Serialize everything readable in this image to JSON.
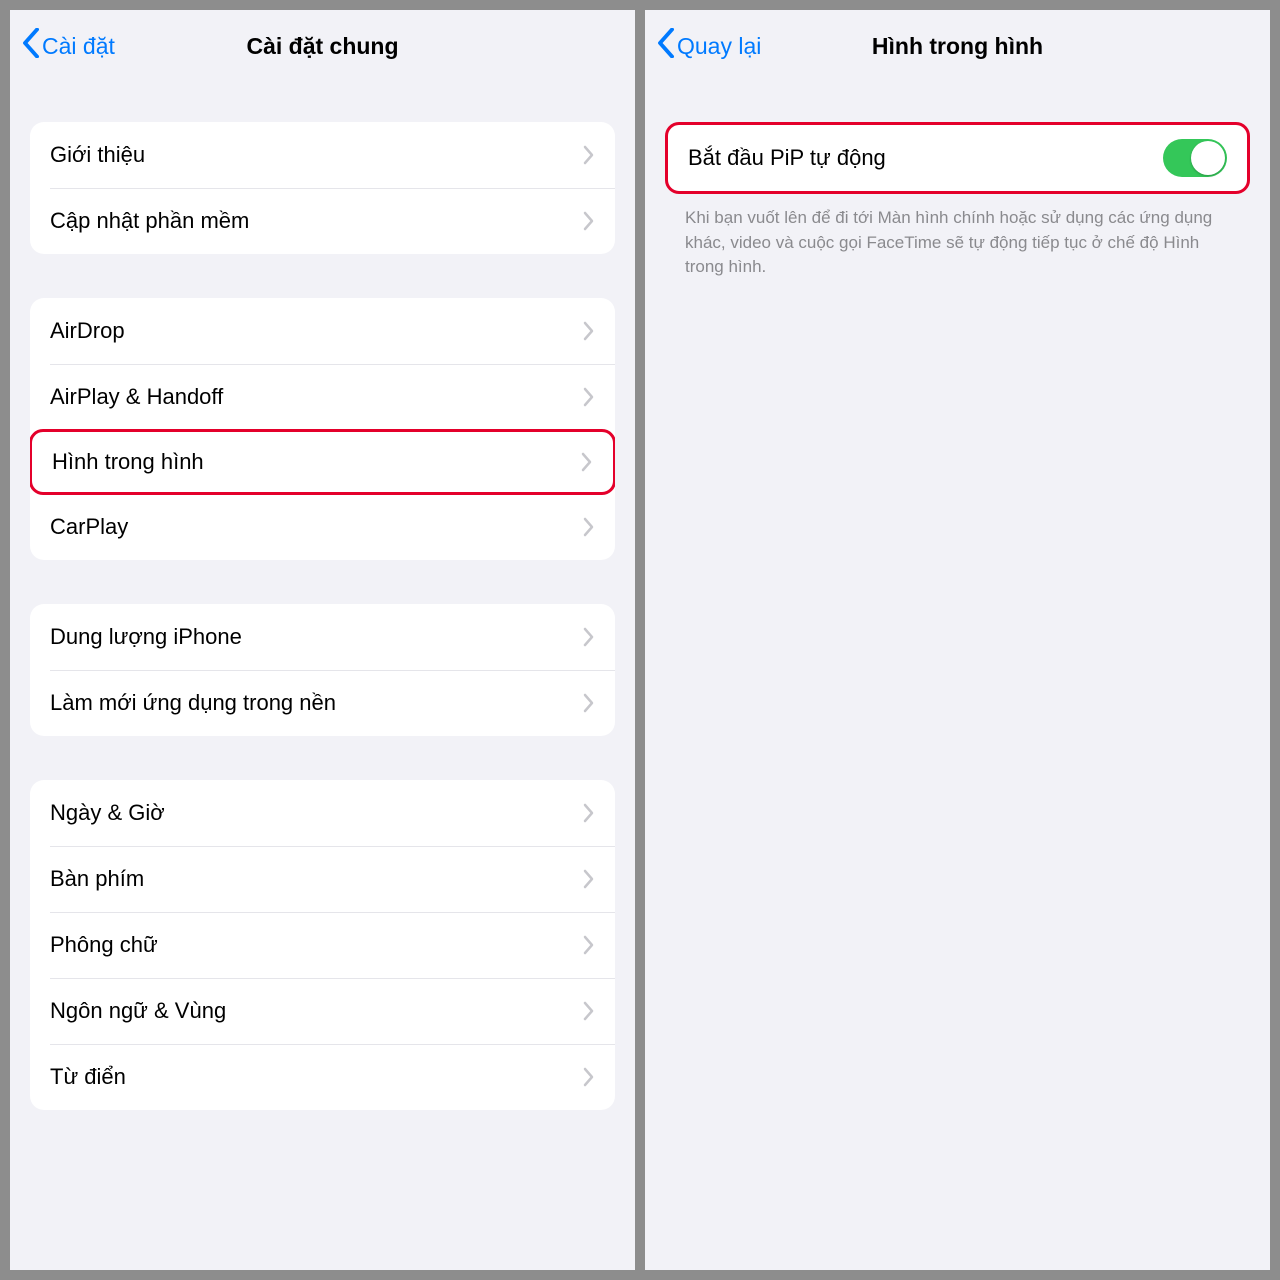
{
  "left": {
    "back_label": "Cài đặt",
    "title": "Cài đặt chung",
    "groups": [
      {
        "items": [
          {
            "label": "Giới thiệu",
            "highlight": false
          },
          {
            "label": "Cập nhật phần mềm",
            "highlight": false
          }
        ]
      },
      {
        "items": [
          {
            "label": "AirDrop",
            "highlight": false
          },
          {
            "label": "AirPlay & Handoff",
            "highlight": false
          },
          {
            "label": "Hình trong hình",
            "highlight": true
          },
          {
            "label": "CarPlay",
            "highlight": false
          }
        ]
      },
      {
        "items": [
          {
            "label": "Dung lượng iPhone",
            "highlight": false
          },
          {
            "label": "Làm mới ứng dụng trong nền",
            "highlight": false
          }
        ]
      },
      {
        "items": [
          {
            "label": "Ngày & Giờ",
            "highlight": false
          },
          {
            "label": "Bàn phím",
            "highlight": false
          },
          {
            "label": "Phông chữ",
            "highlight": false
          },
          {
            "label": "Ngôn ngữ & Vùng",
            "highlight": false
          },
          {
            "label": "Từ điển",
            "highlight": false
          }
        ]
      }
    ]
  },
  "right": {
    "back_label": "Quay lại",
    "title": "Hình trong hình",
    "toggle_label": "Bắt đầu PiP tự động",
    "toggle_on": true,
    "footer": "Khi bạn vuốt lên để đi tới Màn hình chính hoặc sử dụng các ứng dụng khác, video và cuộc gọi FaceTime sẽ tự động tiếp tục ở chế độ Hình trong hình."
  }
}
